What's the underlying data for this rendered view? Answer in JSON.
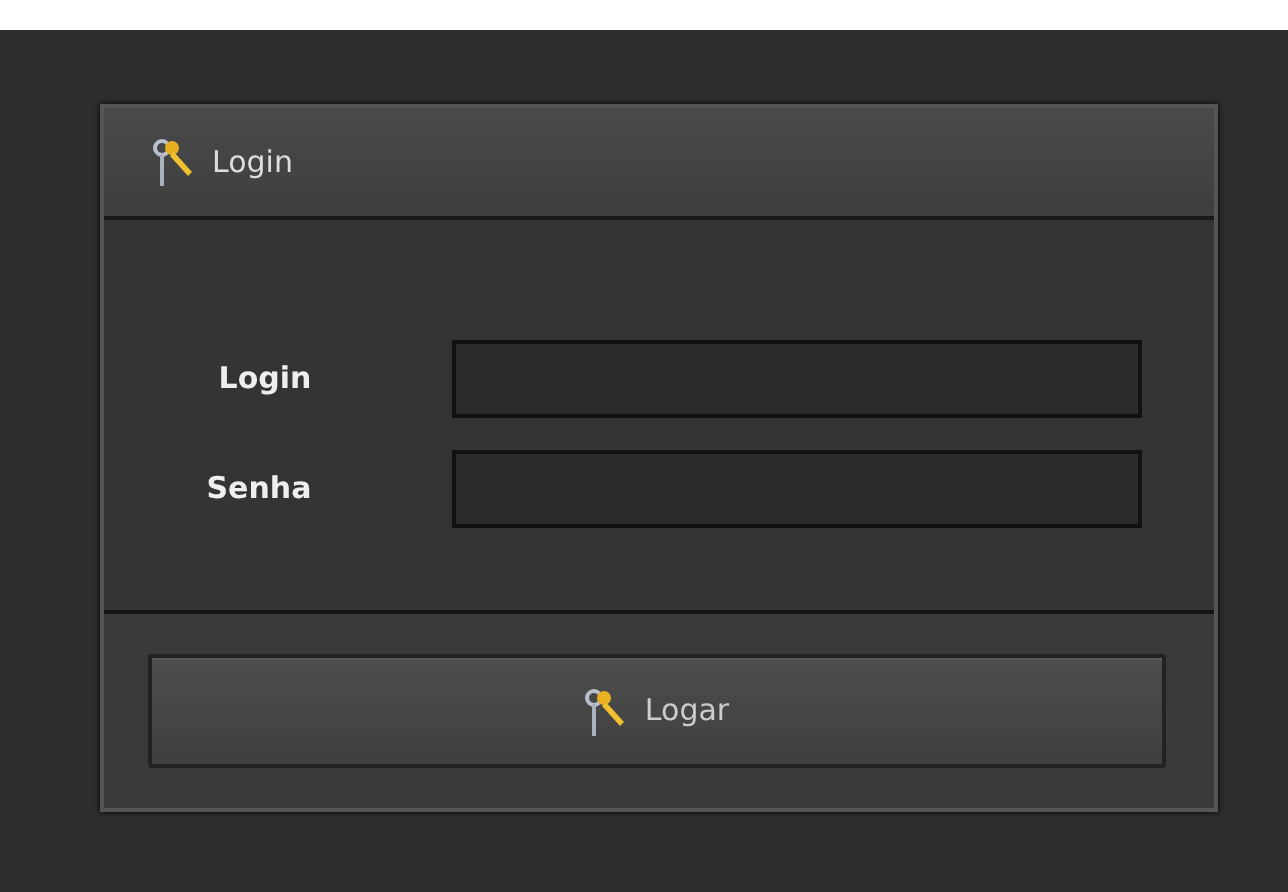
{
  "panel": {
    "title": "Login"
  },
  "fields": [
    {
      "label": "Login"
    },
    {
      "label": "Senha"
    }
  ],
  "button": {
    "label": "Logar"
  }
}
